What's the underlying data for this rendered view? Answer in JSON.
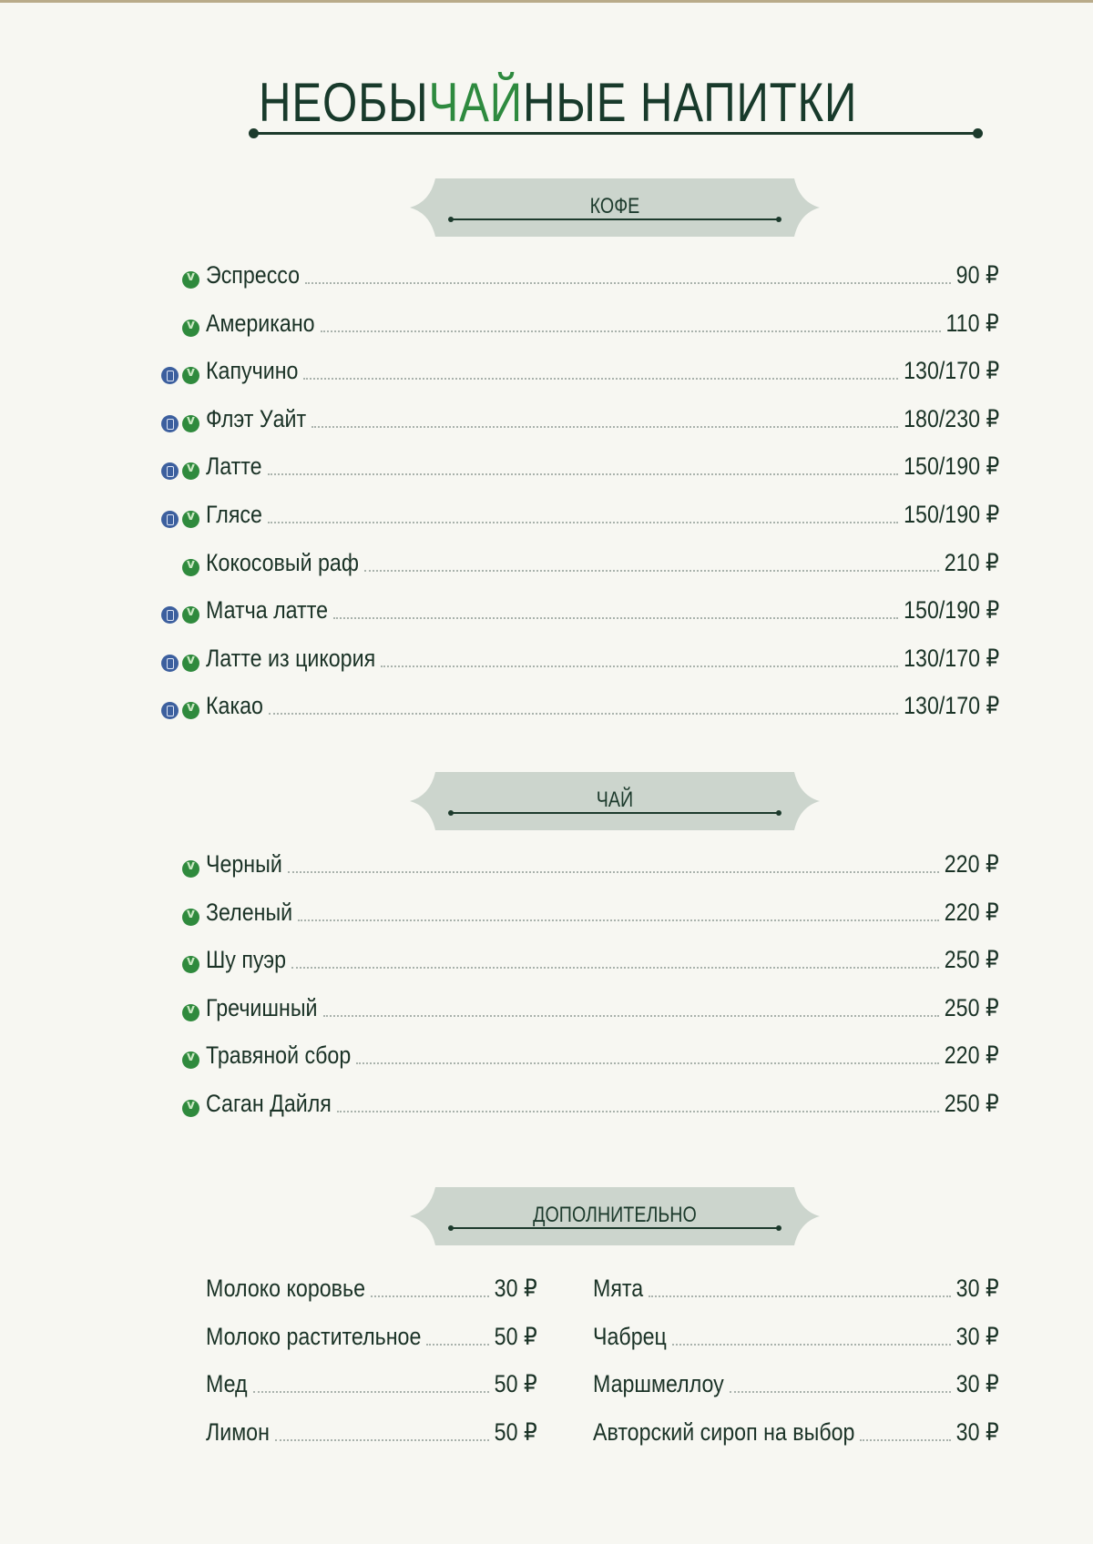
{
  "title": {
    "part1": "НЕОБЫ",
    "accent": "ЧАЙ",
    "part2": "НЫЕ НАПИТКИ"
  },
  "colors": {
    "accent": "#2e8a3f",
    "dark": "#183a2b",
    "banner": "#ccd5cd",
    "veg_icon": "#2f8a3d",
    "milk_icon": "#3c5f9e"
  },
  "icons": {
    "veg": "vegan-v-icon",
    "milk": "milk-bottle-icon"
  },
  "sections": {
    "coffee": {
      "title": "КОФЕ",
      "items": [
        {
          "name": "Эспрессо",
          "price": "90 ₽",
          "icons": [
            "veg"
          ]
        },
        {
          "name": "Американо",
          "price": "110 ₽",
          "icons": [
            "veg"
          ]
        },
        {
          "name": "Капучино",
          "price": "130/170 ₽",
          "icons": [
            "milk",
            "veg"
          ]
        },
        {
          "name": "Флэт Уайт",
          "price": "180/230 ₽",
          "icons": [
            "milk",
            "veg"
          ]
        },
        {
          "name": "Латте",
          "price": "150/190 ₽",
          "icons": [
            "milk",
            "veg"
          ]
        },
        {
          "name": "Глясе",
          "price": "150/190 ₽",
          "icons": [
            "milk",
            "veg"
          ]
        },
        {
          "name": "Кокосовый раф",
          "price": "210 ₽",
          "icons": [
            "veg"
          ]
        },
        {
          "name": "Матча латте",
          "price": "150/190 ₽",
          "icons": [
            "milk",
            "veg"
          ]
        },
        {
          "name": "Латте из цикория",
          "price": "130/170 ₽",
          "icons": [
            "milk",
            "veg"
          ]
        },
        {
          "name": "Какао",
          "price": "130/170 ₽",
          "icons": [
            "milk",
            "veg"
          ]
        }
      ]
    },
    "tea": {
      "title": "ЧАЙ",
      "items": [
        {
          "name": "Черный",
          "price": "220 ₽",
          "icons": [
            "veg"
          ]
        },
        {
          "name": "Зеленый",
          "price": "220 ₽",
          "icons": [
            "veg"
          ]
        },
        {
          "name": "Шу пуэр",
          "price": "250 ₽",
          "icons": [
            "veg"
          ]
        },
        {
          "name": "Гречишный",
          "price": "250 ₽",
          "icons": [
            "veg"
          ]
        },
        {
          "name": "Травяной сбор",
          "price": "220 ₽",
          "icons": [
            "veg"
          ]
        },
        {
          "name": "Саган Дайля",
          "price": "250 ₽",
          "icons": [
            "veg"
          ]
        }
      ]
    },
    "extras": {
      "title": "ДОПОЛНИТЕЛЬНО",
      "left": [
        {
          "name": "Молоко коровье",
          "price": "30 ₽"
        },
        {
          "name": "Молоко растительное",
          "price": "50 ₽"
        },
        {
          "name": "Мед",
          "price": "50 ₽"
        },
        {
          "name": "Лимон",
          "price": "50 ₽"
        }
      ],
      "right": [
        {
          "name": "Мята",
          "price": "30 ₽"
        },
        {
          "name": "Чабрец",
          "price": "30 ₽"
        },
        {
          "name": "Маршмеллоу",
          "price": "30 ₽"
        },
        {
          "name": "Авторский сироп на выбор",
          "price": "30 ₽"
        }
      ]
    }
  }
}
